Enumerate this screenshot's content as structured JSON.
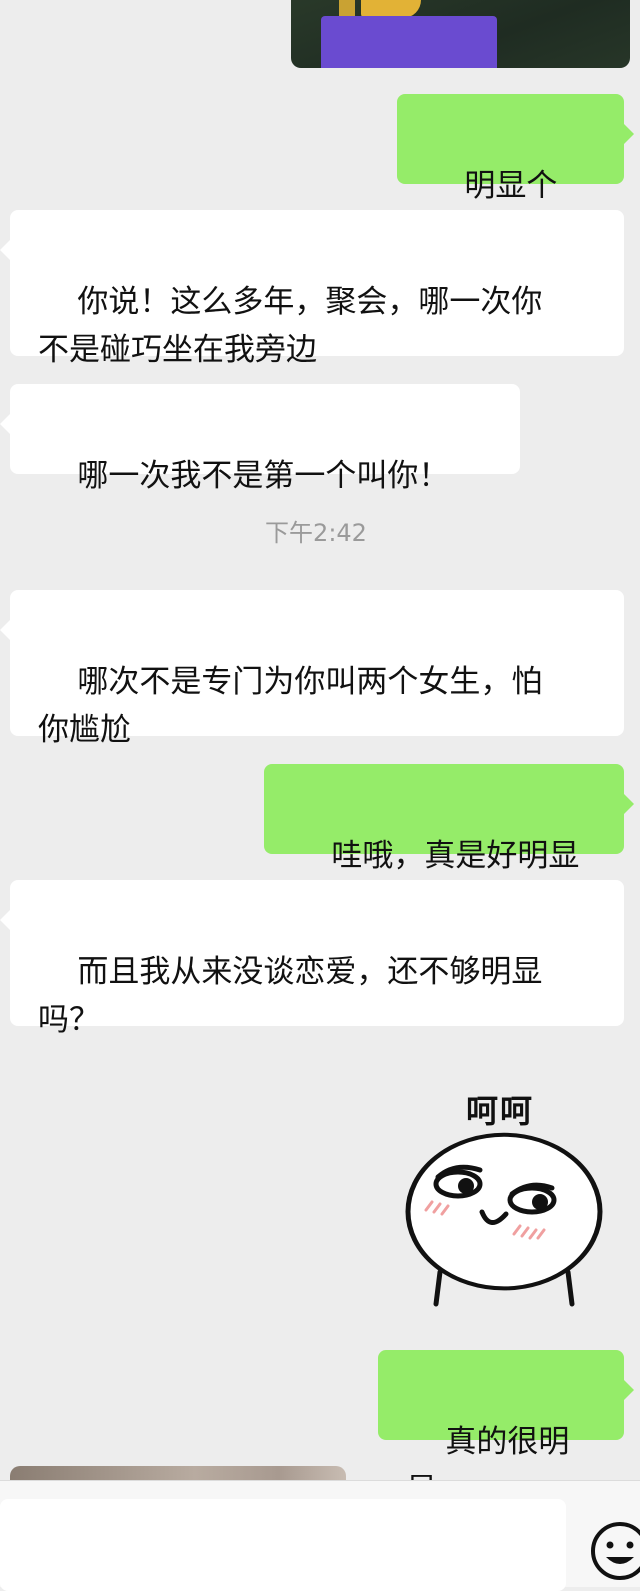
{
  "chat": {
    "messages": [
      {
        "side": "out",
        "text": "明显个🥚"
      },
      {
        "side": "in",
        "text": "你说！这么多年，聚会，哪一次你\n不是碰巧坐在我旁边"
      },
      {
        "side": "in",
        "text": "哪一次我不是第一个叫你！"
      },
      {
        "side": "in",
        "text": "哪次不是专门为你叫两个女生，怕\n你尴尬"
      },
      {
        "side": "out",
        "text": "哇哦，真是好明显"
      },
      {
        "side": "in",
        "text": "而且我从来没谈恋爱，还不够明显\n吗？"
      },
      {
        "side": "out",
        "text": "真的很明显"
      }
    ],
    "timestamp": "下午2:42",
    "sticker": {
      "caption": "呵呵",
      "icon": "smirk-face-sticker"
    }
  },
  "input_bar": {
    "placeholder": "",
    "emoji_icon": "emoji-smile-icon"
  },
  "colors": {
    "background": "#ededed",
    "incoming": "#ffffff",
    "outgoing": "#95ec69",
    "timestamp": "#9a9a9a"
  }
}
